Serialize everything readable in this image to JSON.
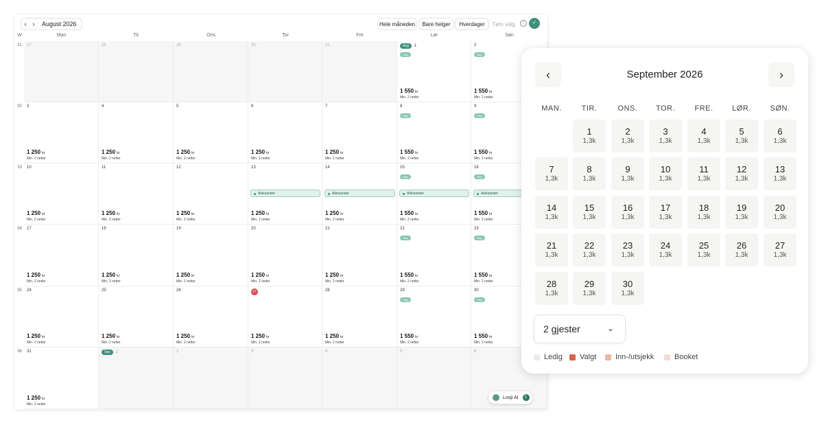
{
  "toolbar": {
    "month_title": "August 2026",
    "prev": "‹",
    "next": "›",
    "buttons": [
      "Hele måneden",
      "Bare helger",
      "Hverdager",
      "Tøm valg"
    ],
    "info": "i",
    "avatar": "✓"
  },
  "calendar": {
    "week_label": "W",
    "day_headers": [
      "Man",
      "Tir",
      "Ons",
      "Tor",
      "Fre",
      "Lør",
      "Søn"
    ],
    "weeks": [
      "31",
      "32",
      "33",
      "34",
      "35",
      "36"
    ],
    "days": [
      "27",
      "28",
      "29",
      "30",
      "31",
      "1",
      "2",
      "3",
      "4",
      "5",
      "6",
      "7",
      "8",
      "9",
      "10",
      "11",
      "12",
      "13",
      "14",
      "15",
      "16",
      "17",
      "18",
      "19",
      "20",
      "21",
      "22",
      "23",
      "24",
      "25",
      "26",
      "27",
      "28",
      "29",
      "30",
      "31",
      "1",
      "2",
      "3",
      "4",
      "5",
      "6"
    ],
    "month_tags": {
      "aug": "Aug",
      "sep": "Sep"
    },
    "high_tag": "Høg",
    "weekday_price": "1 250",
    "weekend_price": "1 550",
    "currency": "kr",
    "min_nights": "Min. 2 netter",
    "booking_name": "Aleksander",
    "colors": {
      "accent": "#3f8f7c",
      "today": "#d94c4c",
      "booking": "#dff1ea"
    }
  },
  "assistant": {
    "label": "Losji AI",
    "count": "1"
  },
  "picker": {
    "title": "September 2026",
    "prev": "‹",
    "next": "›",
    "weekdays": [
      "MAN.",
      "TIR.",
      "ONS.",
      "TOR.",
      "FRE.",
      "LØR.",
      "SØN."
    ],
    "price_label": "1,3k",
    "days": [
      "1",
      "2",
      "3",
      "4",
      "5",
      "6",
      "7",
      "8",
      "9",
      "10",
      "11",
      "12",
      "13",
      "14",
      "15",
      "16",
      "17",
      "18",
      "19",
      "20",
      "21",
      "22",
      "23",
      "24",
      "25",
      "26",
      "27",
      "28",
      "29",
      "30"
    ],
    "guests": "2 gjester",
    "chevron": "⌄",
    "legend": [
      {
        "label": "Ledig",
        "color": "#ebebea"
      },
      {
        "label": "Valgt",
        "color": "#d4644a"
      },
      {
        "label": "Inn-/utsjekk",
        "color": "#e9b8aa"
      },
      {
        "label": "Booket",
        "color": "#f3dcd6"
      }
    ]
  }
}
